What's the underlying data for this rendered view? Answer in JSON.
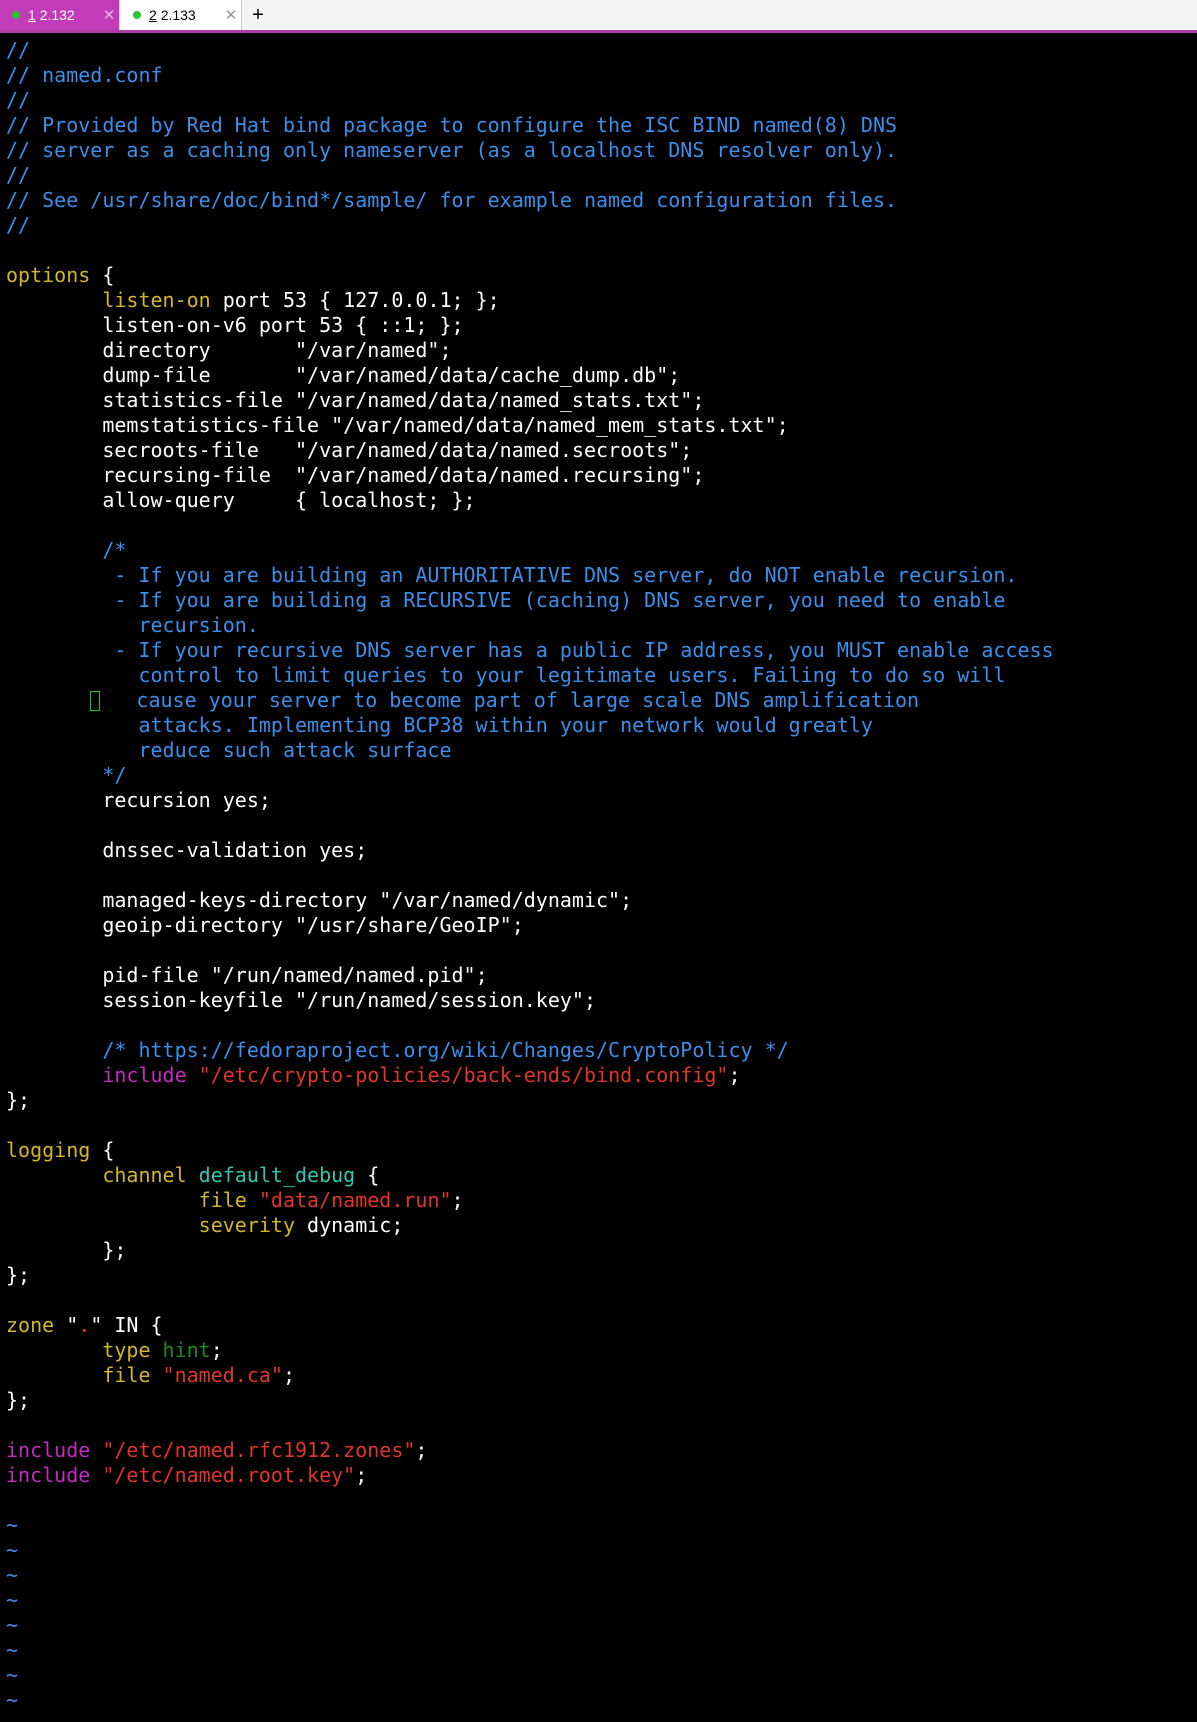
{
  "tabs": [
    {
      "num": "1",
      "title": "2.132"
    },
    {
      "num": "2",
      "title": "2.133"
    }
  ],
  "icons": {
    "tab_close": "close-icon",
    "new_tab": "plus-icon",
    "status_dot": "online-dot-icon"
  },
  "colors": {
    "accent": "#c23bb8",
    "comment": "#3b8eea",
    "keyword": "#d2b52c",
    "include": "#c42bc0",
    "string": "#e0352b",
    "status_dot": "#2ec52e"
  },
  "lines": [
    [
      [
        "cm",
        "//"
      ]
    ],
    [
      [
        "cm",
        "// named.conf"
      ]
    ],
    [
      [
        "cm",
        "//"
      ]
    ],
    [
      [
        "cm",
        "// Provided by Red Hat bind package to configure the ISC BIND named(8) DNS"
      ]
    ],
    [
      [
        "cm",
        "// server as a caching only nameserver (as a localhost DNS resolver only)."
      ]
    ],
    [
      [
        "cm",
        "//"
      ]
    ],
    [
      [
        "cm",
        "// See /usr/share/doc/bind*/sample/ for example named configuration files."
      ]
    ],
    [
      [
        "cm",
        "//"
      ]
    ],
    [],
    [
      [
        "kw",
        "options"
      ],
      [
        "tx",
        " {"
      ]
    ],
    [
      [
        "tx",
        "        "
      ],
      [
        "kw",
        "listen-on"
      ],
      [
        "tx",
        " port 53 { 127.0.0.1; };"
      ]
    ],
    [
      [
        "tx",
        "        listen-on-v6 port 53 { ::1; };"
      ]
    ],
    [
      [
        "tx",
        "        directory       \"/var/named\";"
      ]
    ],
    [
      [
        "tx",
        "        dump-file       \"/var/named/data/cache_dump.db\";"
      ]
    ],
    [
      [
        "tx",
        "        statistics-file \"/var/named/data/named_stats.txt\";"
      ]
    ],
    [
      [
        "tx",
        "        memstatistics-file \"/var/named/data/named_mem_stats.txt\";"
      ]
    ],
    [
      [
        "tx",
        "        secroots-file   \"/var/named/data/named.secroots\";"
      ]
    ],
    [
      [
        "tx",
        "        recursing-file  \"/var/named/data/named.recursing\";"
      ]
    ],
    [
      [
        "tx",
        "        allow-query     { localhost; };"
      ]
    ],
    [],
    [
      [
        "cm",
        "        /*"
      ]
    ],
    [
      [
        "cm",
        "         - If you are building an AUTHORITATIVE DNS server, do NOT enable recursion."
      ]
    ],
    [
      [
        "cm",
        "         - If you are building a RECURSIVE (caching) DNS server, you need to enable"
      ]
    ],
    [
      [
        "cm",
        "           recursion."
      ]
    ],
    [
      [
        "cm",
        "         - If your recursive DNS server has a public IP address, you MUST enable access"
      ]
    ],
    [
      [
        "cm",
        "           control to limit queries to your legitimate users. Failing to do so will"
      ]
    ],
    [
      [
        "tx",
        "       "
      ],
      [
        "cursor",
        ""
      ],
      [
        "cm",
        "   cause your server to become part of large scale DNS amplification"
      ]
    ],
    [
      [
        "cm",
        "           attacks. Implementing BCP38 within your network would greatly"
      ]
    ],
    [
      [
        "cm",
        "           reduce such attack surface"
      ]
    ],
    [
      [
        "cm",
        "        */"
      ]
    ],
    [
      [
        "tx",
        "        recursion yes;"
      ]
    ],
    [],
    [
      [
        "tx",
        "        dnssec-validation yes;"
      ]
    ],
    [],
    [
      [
        "tx",
        "        managed-keys-directory \"/var/named/dynamic\";"
      ]
    ],
    [
      [
        "tx",
        "        geoip-directory \"/usr/share/GeoIP\";"
      ]
    ],
    [],
    [
      [
        "tx",
        "        pid-file \"/run/named/named.pid\";"
      ]
    ],
    [
      [
        "tx",
        "        session-keyfile \"/run/named/session.key\";"
      ]
    ],
    [],
    [
      [
        "cm",
        "        /* https://fedoraproject.org/wiki/Changes/CryptoPolicy */"
      ]
    ],
    [
      [
        "tx",
        "        "
      ],
      [
        "pp",
        "include"
      ],
      [
        "tx",
        " "
      ],
      [
        "str",
        "\"/etc/crypto-policies/back-ends/bind.config\""
      ],
      [
        "tx",
        ";"
      ]
    ],
    [
      [
        "tx",
        "};"
      ]
    ],
    [],
    [
      [
        "kw",
        "logging"
      ],
      [
        "tx",
        " {"
      ]
    ],
    [
      [
        "tx",
        "        "
      ],
      [
        "kw",
        "channel"
      ],
      [
        "tx",
        " "
      ],
      [
        "ty",
        "default_debug"
      ],
      [
        "tx",
        " {"
      ]
    ],
    [
      [
        "tx",
        "                "
      ],
      [
        "kw",
        "file"
      ],
      [
        "tx",
        " "
      ],
      [
        "str",
        "\"data/named.run\""
      ],
      [
        "tx",
        ";"
      ]
    ],
    [
      [
        "tx",
        "                "
      ],
      [
        "kw",
        "severity"
      ],
      [
        "tx",
        " dynamic;"
      ]
    ],
    [
      [
        "tx",
        "        };"
      ]
    ],
    [
      [
        "tx",
        "};"
      ]
    ],
    [],
    [
      [
        "kw",
        "zone"
      ],
      [
        "tx",
        " \""
      ],
      [
        "str",
        "."
      ],
      [
        "tx",
        "\" IN {"
      ]
    ],
    [
      [
        "tx",
        "        "
      ],
      [
        "kw",
        "type"
      ],
      [
        "tx",
        " "
      ],
      [
        "hint",
        "hint"
      ],
      [
        "tx",
        ";"
      ]
    ],
    [
      [
        "tx",
        "        "
      ],
      [
        "kw",
        "file"
      ],
      [
        "tx",
        " "
      ],
      [
        "str",
        "\"named.ca\""
      ],
      [
        "tx",
        ";"
      ]
    ],
    [
      [
        "tx",
        "};"
      ]
    ],
    [],
    [
      [
        "pp",
        "include"
      ],
      [
        "tx",
        " "
      ],
      [
        "str",
        "\"/etc/named.rfc1912.zones\""
      ],
      [
        "tx",
        ";"
      ]
    ],
    [
      [
        "pp",
        "include"
      ],
      [
        "tx",
        " "
      ],
      [
        "str",
        "\"/etc/named.root.key\""
      ],
      [
        "tx",
        ";"
      ]
    ],
    [],
    [
      [
        "tl",
        "~"
      ]
    ],
    [
      [
        "tl",
        "~"
      ]
    ],
    [
      [
        "tl",
        "~"
      ]
    ],
    [
      [
        "tl",
        "~"
      ]
    ],
    [
      [
        "tl",
        "~"
      ]
    ],
    [
      [
        "tl",
        "~"
      ]
    ],
    [
      [
        "tl",
        "~"
      ]
    ],
    [
      [
        "tl",
        "~"
      ]
    ]
  ]
}
